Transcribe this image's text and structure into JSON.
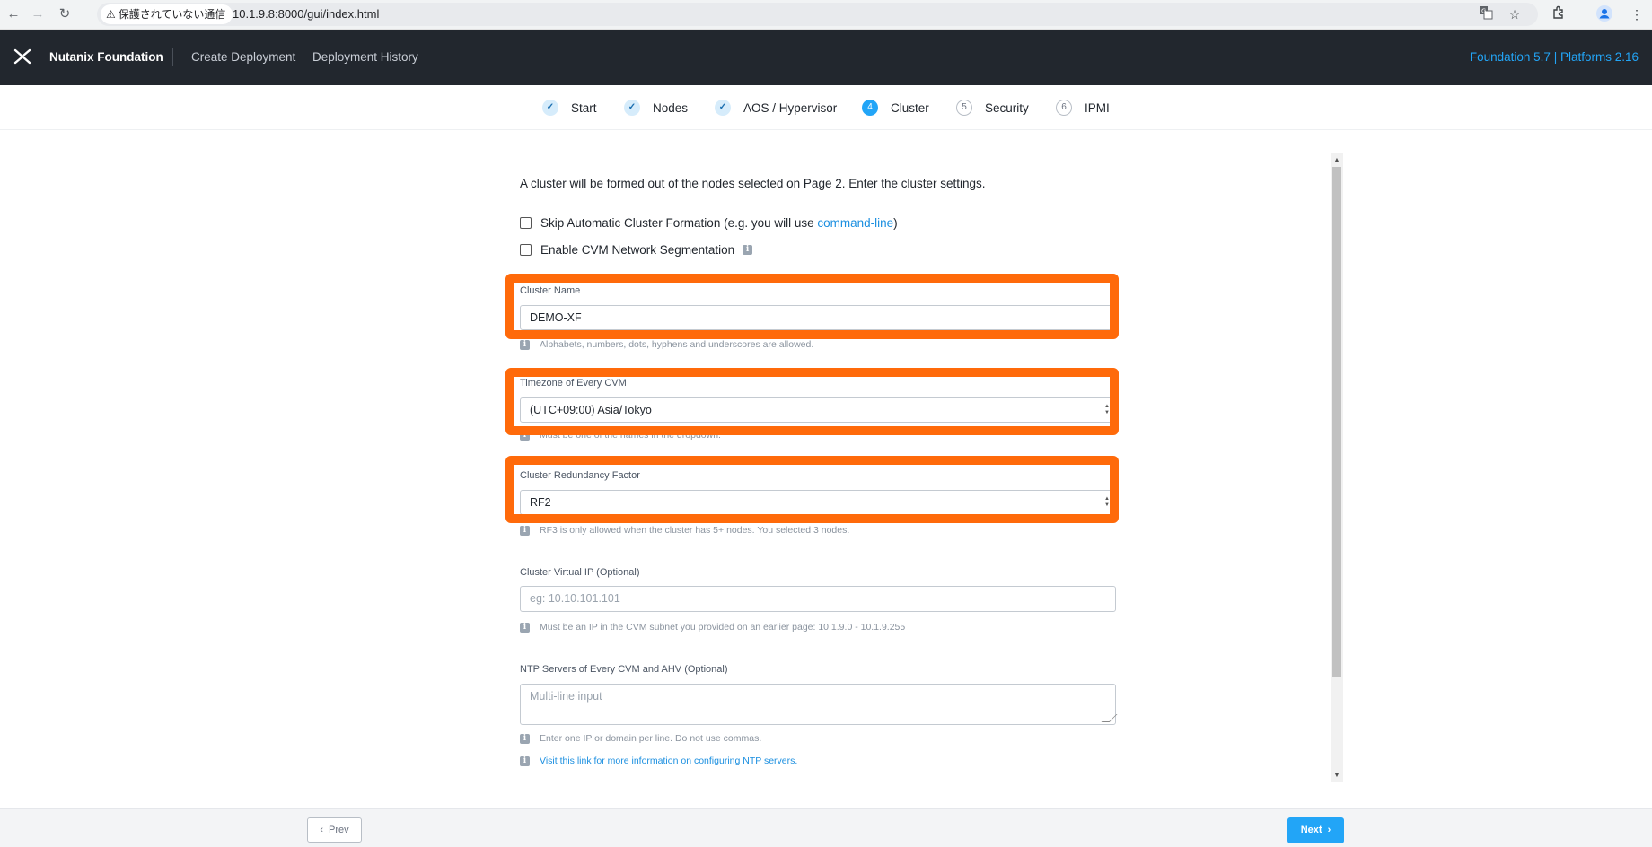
{
  "browser": {
    "security_label": "保護されていない通信",
    "url": "10.1.9.8:8000/gui/index.html"
  },
  "header": {
    "brand": "Nutanix Foundation",
    "nav": [
      "Create Deployment",
      "Deployment History"
    ],
    "version": "Foundation 5.7 | Platforms 2.16",
    "accent_color": "#22a5f7"
  },
  "stepper": {
    "steps": [
      {
        "marker": "✓",
        "label": "Start",
        "state": "done"
      },
      {
        "marker": "✓",
        "label": "Nodes",
        "state": "done"
      },
      {
        "marker": "✓",
        "label": "AOS / Hypervisor",
        "state": "done"
      },
      {
        "marker": "4",
        "label": "Cluster",
        "state": "active"
      },
      {
        "marker": "5",
        "label": "Security",
        "state": "todo"
      },
      {
        "marker": "6",
        "label": "IPMI",
        "state": "todo"
      }
    ]
  },
  "form": {
    "intro": "A cluster will be formed out of the nodes selected on Page 2. Enter the cluster settings.",
    "skip_cluster": {
      "label": "Skip Automatic Cluster Formation (e.g. you will use ",
      "link": "command-line",
      "suffix": ")",
      "checked": false
    },
    "cvm_segmentation": {
      "label": "Enable CVM Network Segmentation",
      "checked": false
    },
    "cluster_name": {
      "label": "Cluster Name",
      "value": "DEMO-XF",
      "help": "Alphabets, numbers, dots, hyphens and underscores are allowed."
    },
    "timezone": {
      "label": "Timezone of Every CVM",
      "value": "(UTC+09:00) Asia/Tokyo",
      "help": "Must be one of the names in the dropdown."
    },
    "redundancy": {
      "label": "Cluster Redundancy Factor",
      "value": "RF2",
      "help": "RF3 is only allowed when the cluster has 5+ nodes. You selected 3 nodes."
    },
    "virtual_ip": {
      "label": "Cluster Virtual IP (Optional)",
      "placeholder": "eg: 10.10.101.101",
      "help": "Must be an IP in the CVM subnet you provided on an earlier page: 10.1.9.0 - 10.1.9.255"
    },
    "ntp": {
      "label": "NTP Servers of Every CVM and AHV (Optional)",
      "placeholder": "Multi-line input",
      "help": "Enter one IP or domain per line. Do not use commas.",
      "link_help": "Visit this link for more information on configuring NTP servers."
    }
  },
  "annotation": {
    "highlight_color": "#ff6a0a"
  },
  "footer": {
    "prev": "Prev",
    "next": "Next"
  }
}
